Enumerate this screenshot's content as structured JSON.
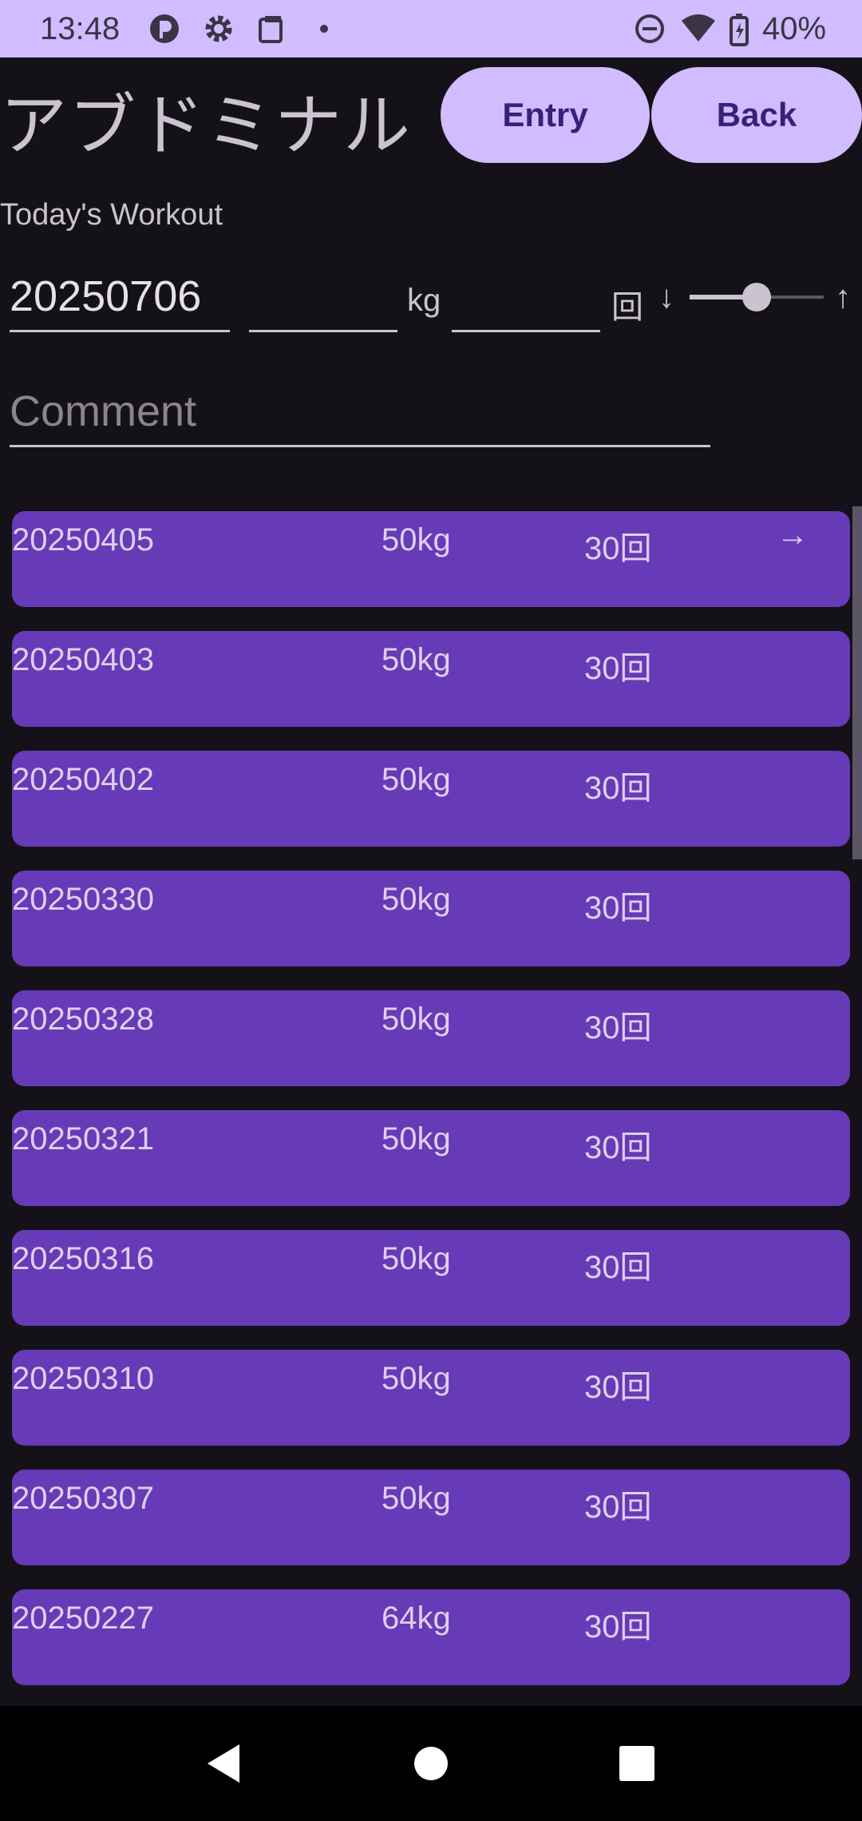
{
  "status_bar": {
    "time": "13:48",
    "battery": "40%",
    "icons": [
      "app-icon",
      "gear-icon",
      "clipboard-icon",
      "dot-icon",
      "do-not-disturb-icon",
      "wifi-icon",
      "battery-icon"
    ]
  },
  "header": {
    "title": "アブドミナル",
    "entry_label": "Entry",
    "back_label": "Back"
  },
  "form": {
    "section_label": "Today's Workout",
    "date_value": "20250706",
    "weight_value": "",
    "weight_unit": "kg",
    "reps_value": "",
    "reps_unit": "回",
    "sort_down": "↓",
    "sort_up": "↑",
    "slider_level": 0.5,
    "comment_placeholder": "Comment"
  },
  "history": [
    {
      "date": "20250405",
      "weight": "50kg",
      "reps": "30回",
      "arrow": "→"
    },
    {
      "date": "20250403",
      "weight": "50kg",
      "reps": "30回",
      "arrow": ""
    },
    {
      "date": "20250402",
      "weight": "50kg",
      "reps": "30回",
      "arrow": ""
    },
    {
      "date": "20250330",
      "weight": "50kg",
      "reps": "30回",
      "arrow": ""
    },
    {
      "date": "20250328",
      "weight": "50kg",
      "reps": "30回",
      "arrow": ""
    },
    {
      "date": "20250321",
      "weight": "50kg",
      "reps": "30回",
      "arrow": ""
    },
    {
      "date": "20250316",
      "weight": "50kg",
      "reps": "30回",
      "arrow": ""
    },
    {
      "date": "20250310",
      "weight": "50kg",
      "reps": "30回",
      "arrow": ""
    },
    {
      "date": "20250307",
      "weight": "50kg",
      "reps": "30回",
      "arrow": ""
    },
    {
      "date": "20250227",
      "weight": "64kg",
      "reps": "30回",
      "arrow": ""
    }
  ],
  "colors": {
    "accent": "#d0bcfe",
    "card": "#673ab7",
    "background": "#141218"
  },
  "nav": {
    "icons": [
      "back-triangle-icon",
      "home-circle-icon",
      "recents-square-icon"
    ]
  }
}
